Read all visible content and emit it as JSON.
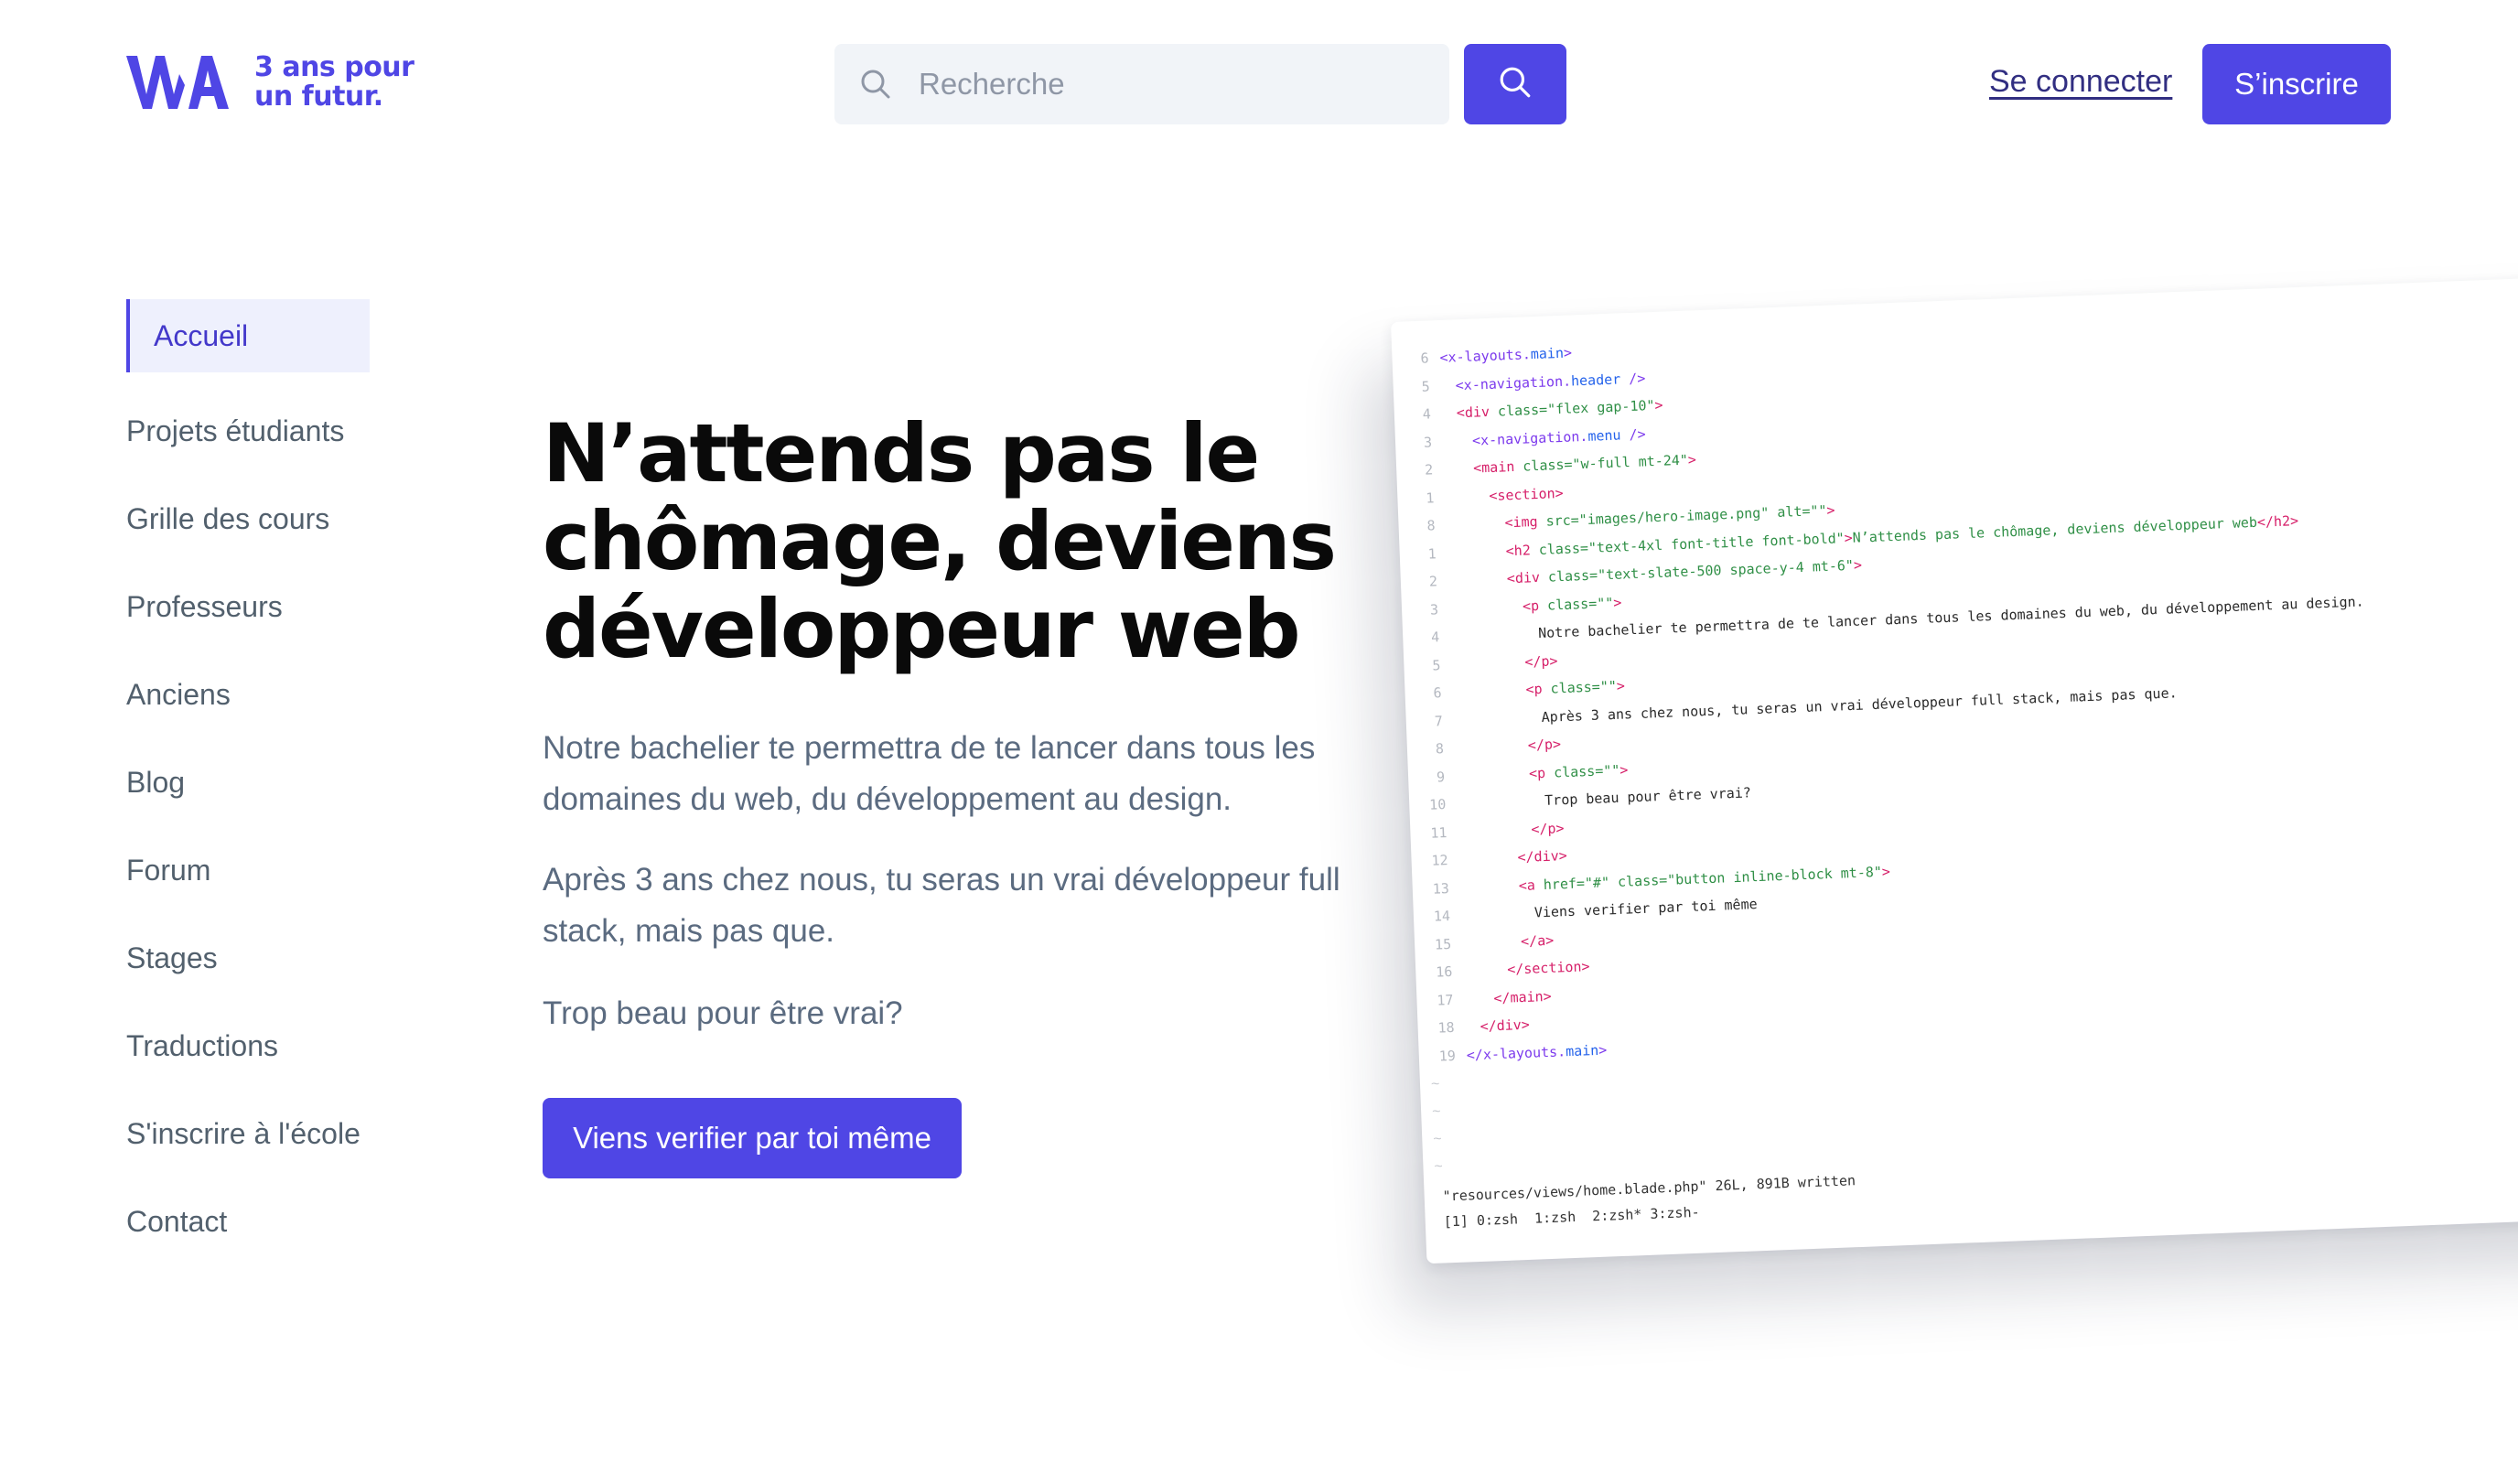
{
  "brand": {
    "logo_mark": "WA",
    "tagline_line1": "3 ans pour",
    "tagline_line2": "un futur.",
    "accent": "#4f46e5"
  },
  "header": {
    "search_placeholder": "Recherche",
    "login_label": "Se connecter",
    "signup_label": "S’inscrire"
  },
  "sidebar": {
    "items": [
      {
        "label": "Accueil",
        "active": true
      },
      {
        "label": "Projets étudiants"
      },
      {
        "label": "Grille des cours"
      },
      {
        "label": "Professeurs"
      },
      {
        "label": "Anciens"
      },
      {
        "label": "Blog"
      },
      {
        "label": "Forum"
      },
      {
        "label": "Stages"
      },
      {
        "label": "Traductions"
      },
      {
        "label": "S'inscrire à l'école"
      },
      {
        "label": "Contact"
      }
    ]
  },
  "hero": {
    "title_line1": "N’attends pas le",
    "title_line2": "chômage, deviens",
    "title_line3": "développeur web",
    "paragraph1": "Notre bachelier te permettra de te lancer dans tous les domaines du web, du développement au design.",
    "paragraph2": "Après 3 ans chez nous, tu seras un vrai développeur full stack, mais pas que.",
    "paragraph3": "Trop beau pour être vrai?",
    "cta_label": "Viens verifier par toi même"
  },
  "code_screenshot": {
    "lines": [
      {
        "n": "6",
        "ind": 0,
        "html": "<span class=\"tag-o\">&lt;x-layouts.</span><span class=\"kw\">main</span><span class=\"tag-o\">&gt;</span>"
      },
      {
        "n": "5",
        "ind": 1,
        "html": "<span class=\"tag-o\">&lt;x-navigation.</span><span class=\"kw\">header</span> <span class=\"tag-o\">/&gt;</span>"
      },
      {
        "n": "4",
        "ind": 1,
        "html": "<span class=\"tag\">&lt;div</span> <span class=\"attr\">class=</span><span class=\"str\">\"flex gap-10\"</span><span class=\"tag\">&gt;</span>"
      },
      {
        "n": "3",
        "ind": 2,
        "html": "<span class=\"tag-o\">&lt;x-navigation.</span><span class=\"kw\">menu</span> <span class=\"tag-o\">/&gt;</span>"
      },
      {
        "n": "2",
        "ind": 2,
        "html": "<span class=\"tag\">&lt;main</span> <span class=\"attr\">class=</span><span class=\"str\">\"w-full mt-24\"</span><span class=\"tag\">&gt;</span>"
      },
      {
        "n": "1",
        "ind": 3,
        "html": "<span class=\"tag\">&lt;section&gt;</span>"
      },
      {
        "n": "8",
        "ind": 4,
        "html": "<span class=\"tag\">&lt;img</span> <span class=\"attr\">src=</span><span class=\"str\">\"images/hero-image.png\"</span> <span class=\"attr\">alt=</span><span class=\"str\">\"\"</span><span class=\"tag\">&gt;</span>"
      },
      {
        "n": "1",
        "ind": 4,
        "html": "<span class=\"tag\">&lt;h2</span> <span class=\"attr\">class=</span><span class=\"str\">\"text-4xl font-title font-bold\"</span><span class=\"tag\">&gt;</span><span class=\"str\">N’attends pas le chômage, deviens développeur web</span><span class=\"tag\">&lt;/h2&gt;</span>"
      },
      {
        "n": "2",
        "ind": 4,
        "html": "<span class=\"tag\">&lt;div</span> <span class=\"attr\">class=</span><span class=\"str\">\"text-slate-500 space-y-4 mt-6\"</span><span class=\"tag\">&gt;</span>"
      },
      {
        "n": "3",
        "ind": 5,
        "html": "<span class=\"tag\">&lt;p</span> <span class=\"attr\">class=</span><span class=\"str\">\"\"</span><span class=\"tag\">&gt;</span>"
      },
      {
        "n": "4",
        "ind": 6,
        "html": "Notre bachelier te permettra de te lancer dans tous les domaines du web, du développement au design."
      },
      {
        "n": "5",
        "ind": 5,
        "html": "<span class=\"tag\">&lt;/p&gt;</span>"
      },
      {
        "n": "6",
        "ind": 5,
        "html": "<span class=\"tag\">&lt;p</span> <span class=\"attr\">class=</span><span class=\"str\">\"\"</span><span class=\"tag\">&gt;</span>"
      },
      {
        "n": "7",
        "ind": 6,
        "html": "Après 3 ans chez nous, tu seras un vrai développeur full stack, mais pas que."
      },
      {
        "n": "8",
        "ind": 5,
        "html": "<span class=\"tag\">&lt;/p&gt;</span>"
      },
      {
        "n": "9",
        "ind": 5,
        "html": "<span class=\"tag\">&lt;p</span> <span class=\"attr\">class=</span><span class=\"str\">\"\"</span><span class=\"tag\">&gt;</span>"
      },
      {
        "n": "10",
        "ind": 6,
        "html": "Trop beau pour être vrai?"
      },
      {
        "n": "11",
        "ind": 5,
        "html": "<span class=\"tag\">&lt;/p&gt;</span>"
      },
      {
        "n": "12",
        "ind": 4,
        "html": "<span class=\"tag\">&lt;/div&gt;</span>"
      },
      {
        "n": "13",
        "ind": 4,
        "html": "<span class=\"tag\">&lt;a</span> <span class=\"attr\">href=</span><span class=\"str\">\"#\"</span> <span class=\"attr\">class=</span><span class=\"str\">\"button inline-block mt-8\"</span><span class=\"tag\">&gt;</span>"
      },
      {
        "n": "14",
        "ind": 5,
        "html": "Viens verifier par toi même"
      },
      {
        "n": "15",
        "ind": 4,
        "html": "<span class=\"tag\">&lt;/a&gt;</span>"
      },
      {
        "n": "16",
        "ind": 3,
        "html": "<span class=\"tag\">&lt;/section&gt;</span>"
      },
      {
        "n": "17",
        "ind": 2,
        "html": "<span class=\"tag\">&lt;/main&gt;</span>"
      },
      {
        "n": "18",
        "ind": 1,
        "html": "<span class=\"tag\">&lt;/div&gt;</span>"
      },
      {
        "n": "19",
        "ind": 0,
        "html": "<span class=\"tag-o\">&lt;/x-layouts.</span><span class=\"kw\">main</span><span class=\"tag-o\">&gt;</span>"
      }
    ],
    "status_line": "\"resources/views/home.blade.php\" 26L, 891B written",
    "tmux_line": "[1] 0:zsh  1:zsh  2:zsh* 3:zsh-"
  }
}
